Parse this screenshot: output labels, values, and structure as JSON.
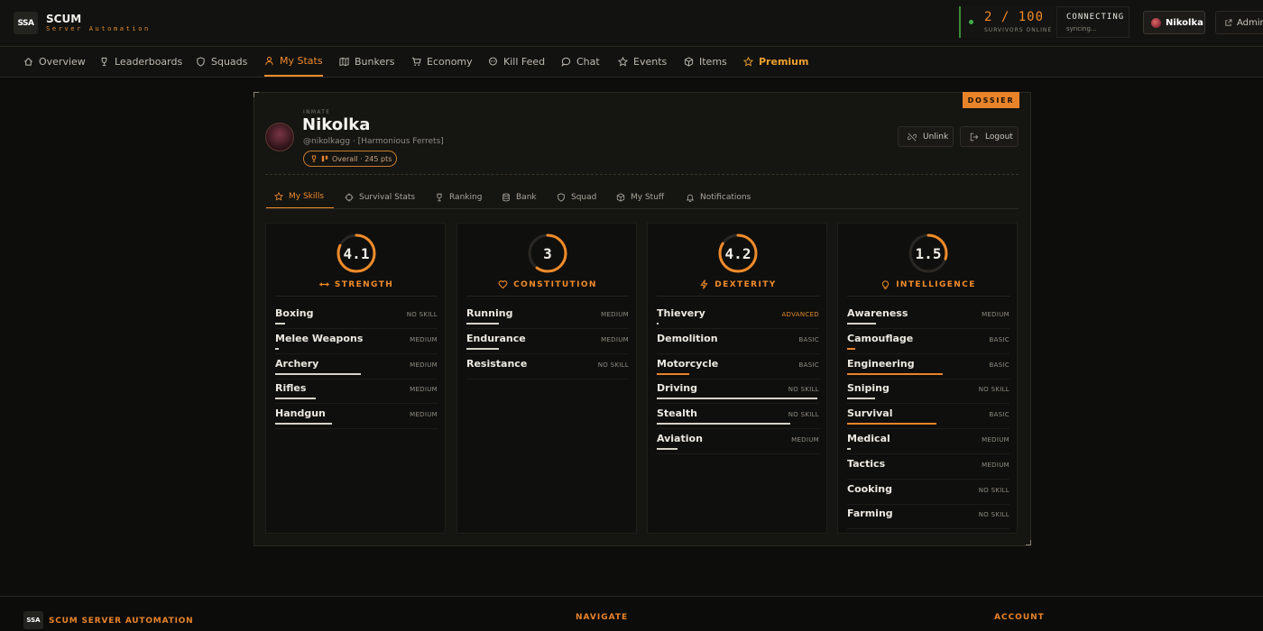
{
  "header": {
    "logo_text": "SSA",
    "brand_name": "SCUM",
    "brand_sub": "Server Automation",
    "online_count": "2 / 100",
    "online_label": "SURVIVORS ONLINE",
    "status_title": "CONNECTING",
    "status_sub": "syncing...",
    "user_label": "Nikolka",
    "admin_label": "Admin"
  },
  "nav": [
    {
      "label": "Overview",
      "icon": "home-icon"
    },
    {
      "label": "Leaderboards",
      "icon": "trophy-icon"
    },
    {
      "label": "Squads",
      "icon": "shield-icon"
    },
    {
      "label": "My Stats",
      "icon": "user-icon",
      "active": true
    },
    {
      "label": "Bunkers",
      "icon": "map-icon"
    },
    {
      "label": "Economy",
      "icon": "cart-icon"
    },
    {
      "label": "Kill Feed",
      "icon": "skull-icon"
    },
    {
      "label": "Chat",
      "icon": "chat-icon"
    },
    {
      "label": "Events",
      "icon": "star-icon"
    },
    {
      "label": "Items",
      "icon": "box-icon"
    },
    {
      "label": "Premium",
      "icon": "star-icon"
    }
  ],
  "dossier": {
    "tag": "DOSSIER",
    "inmate_tag": "INMATE",
    "name": "Nikolka",
    "handle": "@nikolkagg · [Harmonious Ferrets]",
    "rank": "Overall · 245 pts",
    "unlink_label": "Unlink",
    "logout_label": "Logout"
  },
  "subtabs": [
    {
      "label": "My Skills",
      "icon": "star-icon",
      "active": true
    },
    {
      "label": "Survival Stats",
      "icon": "crosshair-icon"
    },
    {
      "label": "Ranking",
      "icon": "trophy-icon"
    },
    {
      "label": "Bank",
      "icon": "bank-icon"
    },
    {
      "label": "Squad",
      "icon": "shield-icon"
    },
    {
      "label": "My Stuff",
      "icon": "box-icon"
    },
    {
      "label": "Notifications",
      "icon": "bell-icon"
    }
  ],
  "attributes": [
    {
      "value": "4.1",
      "label": "STRENGTH",
      "icon": "dumbbell-icon",
      "fill": 0.82,
      "skills": [
        {
          "name": "Boxing",
          "level": "NO SKILL",
          "progress": 0.06
        },
        {
          "name": "Melee Weapons",
          "level": "MEDIUM",
          "progress": 0.02
        },
        {
          "name": "Archery",
          "level": "MEDIUM",
          "progress": 0.53
        },
        {
          "name": "Rifles",
          "level": "MEDIUM",
          "progress": 0.25
        },
        {
          "name": "Handgun",
          "level": "MEDIUM",
          "progress": 0.35
        }
      ]
    },
    {
      "value": "3",
      "label": "CONSTITUTION",
      "icon": "heart-icon",
      "fill": 0.6,
      "skills": [
        {
          "name": "Running",
          "level": "MEDIUM",
          "progress": 0.2
        },
        {
          "name": "Endurance",
          "level": "MEDIUM",
          "progress": 0.2
        },
        {
          "name": "Resistance",
          "level": "NO SKILL",
          "progress": 0
        }
      ]
    },
    {
      "value": "4.2",
      "label": "DEXTERITY",
      "icon": "bolt-icon",
      "fill": 0.84,
      "skills": [
        {
          "name": "Thievery",
          "level": "ADVANCED",
          "progress": 0.01
        },
        {
          "name": "Demolition",
          "level": "BASIC",
          "progress": 0
        },
        {
          "name": "Motorcycle",
          "level": "BASIC",
          "progress": 0.2,
          "orange": true
        },
        {
          "name": "Driving",
          "level": "NO SKILL",
          "progress": 0.99
        },
        {
          "name": "Stealth",
          "level": "NO SKILL",
          "progress": 0.82
        },
        {
          "name": "Aviation",
          "level": "MEDIUM",
          "progress": 0.13
        }
      ]
    },
    {
      "value": "1.5",
      "label": "INTELLIGENCE",
      "icon": "bulb-icon",
      "fill": 0.3,
      "skills": [
        {
          "name": "Awareness",
          "level": "MEDIUM",
          "progress": 0.18
        },
        {
          "name": "Camouflage",
          "level": "BASIC",
          "progress": 0.05,
          "orange": true
        },
        {
          "name": "Engineering",
          "level": "BASIC",
          "progress": 0.59,
          "orange": true
        },
        {
          "name": "Sniping",
          "level": "NO SKILL",
          "progress": 0.17
        },
        {
          "name": "Survival",
          "level": "BASIC",
          "progress": 0.55,
          "orange": true
        },
        {
          "name": "Medical",
          "level": "MEDIUM",
          "progress": 0.02
        },
        {
          "name": "Tactics",
          "level": "MEDIUM",
          "progress": 0
        },
        {
          "name": "Cooking",
          "level": "NO SKILL",
          "progress": 0
        },
        {
          "name": "Farming",
          "level": "NO SKILL",
          "progress": 0
        }
      ]
    }
  ],
  "footer": {
    "logo_text": "SSA",
    "brand": "SCUM SERVER AUTOMATION",
    "navigate_heading": "NAVIGATE",
    "account_heading": "ACCOUNT"
  },
  "colors": {
    "accent": "#f08b2a",
    "online": "#3fae4a",
    "background": "#0d0d0b"
  }
}
